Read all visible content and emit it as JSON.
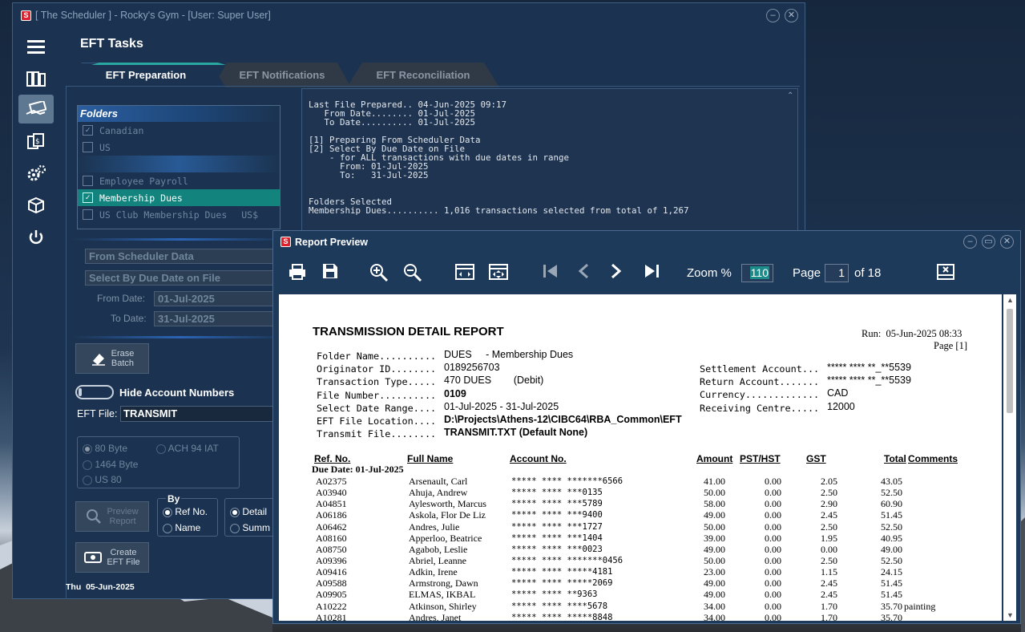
{
  "main_window": {
    "title": "[ The Scheduler ] - Rocky's Gym - [User: Super User]",
    "app_icon": "S",
    "task_title": "EFT Tasks",
    "tabs": [
      "EFT Preparation",
      "EFT Notifications",
      "EFT Reconciliation"
    ],
    "folders": {
      "header": "Folders",
      "items": [
        {
          "label": "Canadian",
          "checked": true
        },
        {
          "label": "US",
          "checked": false
        },
        {
          "label": "Employee Payroll",
          "checked": false
        },
        {
          "label": "Membership Dues",
          "checked": true,
          "selected": true
        },
        {
          "label": "US Club Membership Dues",
          "suffix": "US$",
          "checked": false
        }
      ]
    },
    "log_lines": [
      "Last File Prepared.. 04-Jun-2025 09:17",
      "   From Date........ 01-Jul-2025",
      "   To Date.......... 01-Jul-2025",
      "",
      "[1] Preparing From Scheduler Data",
      "[2] Select By Due Date on File",
      "    - for ALL transactions with due dates in range",
      "      From: 01-Jul-2025",
      "      To:   31-Jul-2025",
      "",
      "",
      "Folders Selected",
      "Membership Dues.......... 1,016 transactions selected from total of 1,267"
    ],
    "source_select": "From Scheduler Data",
    "method_select": "Select By Due Date on File",
    "from_date_label": "From Date:",
    "from_date": "01-Jul-2025",
    "to_date_label": "To Date:",
    "to_date": "31-Jul-2025",
    "erase_batch": "Erase\nBatch",
    "hide_account_label": "Hide Account Numbers",
    "eft_file_label": "EFT File:",
    "eft_file_value": "TRANSMIT",
    "formats": [
      "80 Byte",
      "1464 Byte",
      "US 80",
      "ACH 94 IAT"
    ],
    "by_label": "By",
    "by_options": [
      "Ref No.",
      "Name"
    ],
    "detail_options": [
      "Detail",
      "Summ"
    ],
    "preview_report": "Preview\nReport",
    "create_eft": "Create\nEFT File",
    "status_date": "Thu  05-Jun-2025"
  },
  "report_preview": {
    "title": "Report Preview",
    "zoom_label": "Zoom %",
    "zoom_value": "110",
    "page_label": "Page",
    "page_value": "1",
    "of_label": "of 18",
    "report": {
      "title": "TRANSMISSION DETAIL REPORT",
      "run": "Run:  05-Jun-2025 08:33",
      "page": "Page [1]",
      "left_labels": [
        "Folder Name..........",
        "Originator ID........",
        "Transaction Type.....",
        "File Number..........",
        "Select Date Range....",
        "EFT File Location....",
        "Transmit File........"
      ],
      "left_values": [
        "DUES     - Membership Dues",
        "0189256703",
        "470 DUES        (Debit)",
        "0109",
        "01-Jul-2025 - 31-Jul-2025",
        "D:\\Projects\\Athens-12\\CIBC64\\RBA_Common\\EFT",
        "TRANSMIT.TXT (Default None)"
      ],
      "right_labels": [
        "Settlement Account...",
        "Return Account.......",
        "Currency.............",
        "Receiving Centre....."
      ],
      "right_values": [
        "***** **** **_**5539",
        "***** **** **_**5539",
        "CAD",
        "12000"
      ],
      "columns": [
        "Ref. No.",
        "Full Name",
        "Account No.",
        "Amount",
        "PST/HST",
        "GST",
        "Total",
        "Comments"
      ],
      "group_label": "Due Date: 01-Jul-2025",
      "rows": [
        [
          "A02375",
          "Arsenault, Carl",
          "***** **** *******6566",
          "41.00",
          "0.00",
          "2.05",
          "43.05",
          ""
        ],
        [
          "A03940",
          "Ahuja, Andrew",
          "***** **** ***0135",
          "50.00",
          "0.00",
          "2.50",
          "52.50",
          ""
        ],
        [
          "A04851",
          "Aylesworth, Marcus",
          "***** **** ***5789",
          "58.00",
          "0.00",
          "2.90",
          "60.90",
          ""
        ],
        [
          "A06186",
          "Askola, Flor De Liz",
          "***** **** ***9400",
          "49.00",
          "0.00",
          "2.45",
          "51.45",
          ""
        ],
        [
          "A06462",
          "Andres, Julie",
          "***** **** ***1727",
          "50.00",
          "0.00",
          "2.50",
          "52.50",
          ""
        ],
        [
          "A08160",
          "Apperloo, Beatrice",
          "***** **** ***1404",
          "39.00",
          "0.00",
          "1.95",
          "40.95",
          ""
        ],
        [
          "A08750",
          "Agabob, Leslie",
          "***** **** ***0023",
          "49.00",
          "0.00",
          "0.00",
          "49.00",
          ""
        ],
        [
          "A09396",
          "Abriel, Leanne",
          "***** **** *******0456",
          "50.00",
          "0.00",
          "2.50",
          "52.50",
          ""
        ],
        [
          "A09416",
          "Adkin, Irene",
          "***** **** *****4181",
          "23.00",
          "0.00",
          "1.15",
          "24.15",
          ""
        ],
        [
          "A09588",
          "Armstrong, Dawn",
          "***** **** *****2069",
          "49.00",
          "0.00",
          "2.45",
          "51.45",
          ""
        ],
        [
          "A09905",
          "ELMAS, IKBAL",
          "***** **** **9363",
          "49.00",
          "0.00",
          "2.45",
          "51.45",
          ""
        ],
        [
          "A10222",
          "Atkinson, Shirley",
          "***** **** ****5678",
          "34.00",
          "0.00",
          "1.70",
          "35.70",
          "painting"
        ],
        [
          "A10281",
          "Andres, Janet",
          "***** **** *****8848",
          "34.00",
          "0.00",
          "1.70",
          "35.70",
          ""
        ]
      ]
    }
  }
}
